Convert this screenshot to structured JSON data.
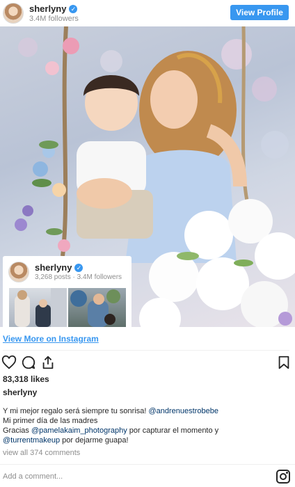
{
  "header": {
    "username": "sherlyny",
    "followers": "3.4M followers",
    "view_profile_label": "View Profile"
  },
  "photo": {
    "alt_subject": "photo"
  },
  "profile_card": {
    "username": "sherlyny",
    "stats": "3,268 posts · 3.4M followers"
  },
  "view_more_label": "View More on Instagram",
  "actions": {
    "like_icon": "heart-icon",
    "comment_icon": "comment-icon",
    "share_icon": "share-icon",
    "save_icon": "bookmark-icon"
  },
  "likes": "83,318 likes",
  "caption": {
    "username": "sherlyny",
    "line1_text": "Y mi mejor regalo será siempre tu sonrisa! ",
    "line1_mention": "@andrenuestrobebe",
    "line2": "Mi primer día de las madres",
    "line3_prefix": "Gracias ",
    "line3_mention": "@pamelakaim_photography",
    "line3_suffix": " por capturar el momento y",
    "line4_mention": "@turrentmakeup",
    "line4_suffix": " por dejarme guapa!"
  },
  "view_comments": "view all 374 comments",
  "comment_placeholder": "Add a comment...",
  "colors": {
    "accent": "#3897f0",
    "text": "#262626",
    "muted": "#8e8e8e"
  }
}
